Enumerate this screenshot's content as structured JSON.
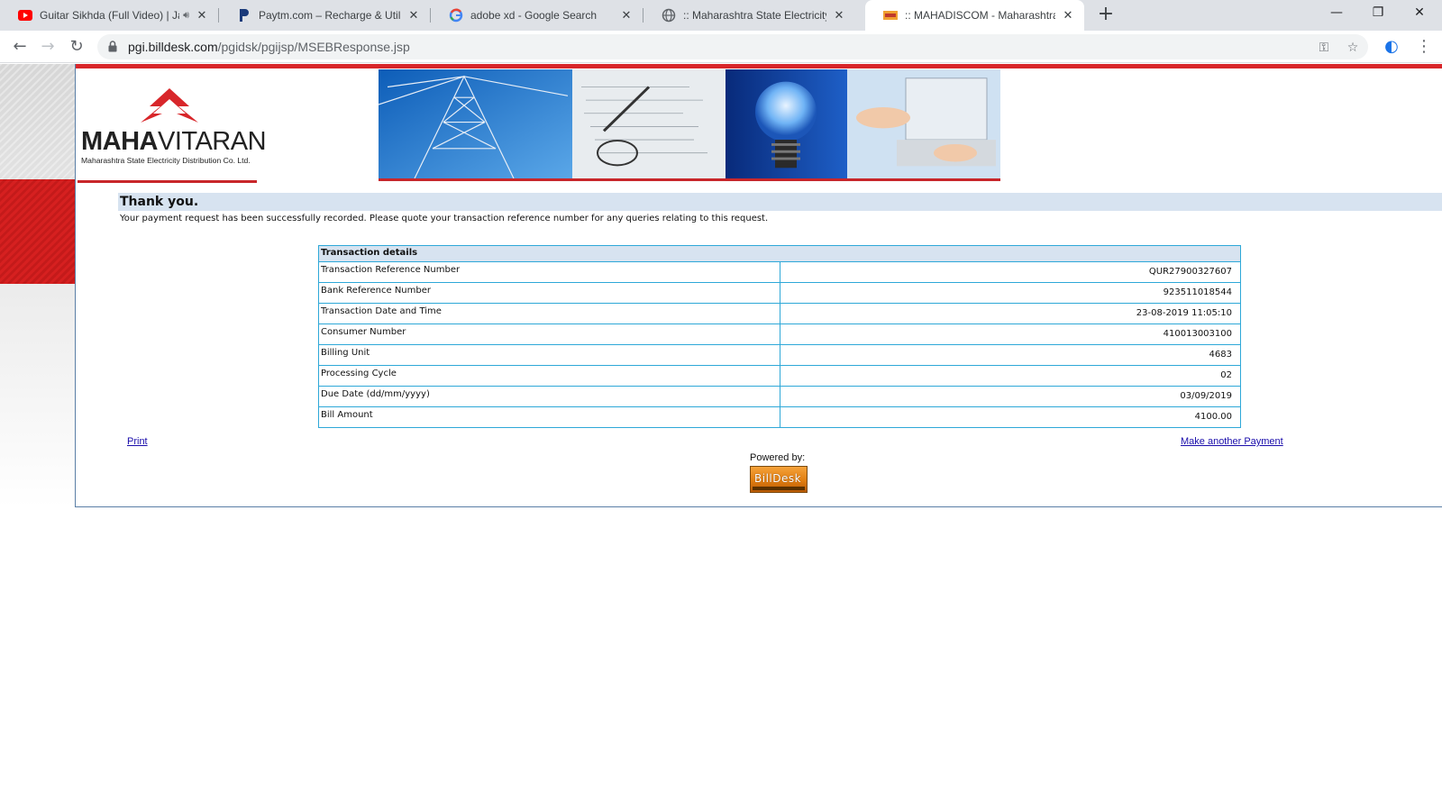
{
  "browser": {
    "tabs": [
      {
        "title": "Guitar Sikhda (Full Video) | Ja",
        "icon": "youtube-icon",
        "audio": true
      },
      {
        "title": "Paytm.com – Recharge & Utility P",
        "icon": "paytm-icon"
      },
      {
        "title": "adobe xd - Google Search",
        "icon": "google-icon"
      },
      {
        "title": ":: Maharashtra State Electricity Di",
        "icon": "globe-icon"
      },
      {
        "title": ":: MAHADISCOM - Maharashtra S",
        "icon": "mahadiscom-icon",
        "active": true
      }
    ],
    "new_tab": "+",
    "url_host": "pgi.billdesk.com",
    "url_path": "/pgidsk/pgijsp/MSEBResponse.jsp"
  },
  "page": {
    "logo": {
      "name_bold": "MAHA",
      "name_regular": "VITARAN",
      "subtitle": "Maharashtra State Electricity Distribution Co. Ltd."
    },
    "thanks_title": "Thank you.",
    "thanks_message": "Your payment request has been successfully recorded. Please quote your transaction reference number for any queries relating to this request.",
    "transaction": {
      "heading": "Transaction details",
      "rows": [
        {
          "label": "Transaction Reference Number",
          "value": "QUR27900327607"
        },
        {
          "label": "Bank Reference Number",
          "value": "923511018544"
        },
        {
          "label": "Transaction Date and Time",
          "value": "23-08-2019 11:05:10"
        },
        {
          "label": "Consumer Number",
          "value": "410013003100"
        },
        {
          "label": "Billing Unit",
          "value": "4683"
        },
        {
          "label": "Processing Cycle",
          "value": "02"
        },
        {
          "label": "Due Date (dd/mm/yyyy)",
          "value": "03/09/2019"
        },
        {
          "label": "Bill Amount",
          "value": "4100.00"
        }
      ]
    },
    "print_link": "Print",
    "another_payment_link": "Make another Payment",
    "powered_by": "Powered by:",
    "billdesk_logo_text": "BillDesk"
  },
  "colors": {
    "brand_red": "#d8262a",
    "table_border": "#2ea8d8",
    "header_fill": "#d7e3f0"
  }
}
